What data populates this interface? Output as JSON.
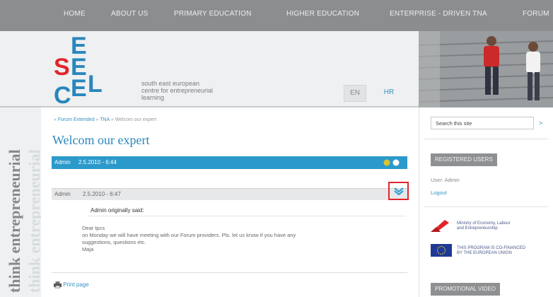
{
  "nav": {
    "items": [
      "HOME",
      "ABOUT US",
      "PRIMARY EDUCATION",
      "HIGHER EDUCATION",
      "ENTERPRISE - DRIVEN TNA",
      "FORUM"
    ]
  },
  "logo": {
    "letters": [
      "S",
      "E",
      "E",
      "C",
      "E",
      "L"
    ],
    "subtitle": [
      "south east european",
      "centre for entrepreneurial",
      "learning"
    ]
  },
  "languages": [
    "EN",
    "HR"
  ],
  "sidebar": {
    "tagline": "think entrepreneurial"
  },
  "breadcrumb": [
    "Forum Extended",
    "TNA",
    "Welcom our expert"
  ],
  "page": {
    "title": "Welcom our expert"
  },
  "posts": [
    {
      "author": "Admin",
      "date": "2.5.2010 - 6:44"
    },
    {
      "author": "Admin",
      "date": "2.5.2010 - 6:47"
    }
  ],
  "quote": {
    "title": "Admin originally said:"
  },
  "post_body": [
    "Dear tpcs",
    "on Monday we will have meeting with our Forum providers. Pls. let us know if you have any",
    "suggestions, questions etc.",
    "Maja"
  ],
  "print_label": "Print page",
  "search": {
    "placeholder": "Search this site",
    "go": ">"
  },
  "registered": {
    "heading": "REGISTERED USERS",
    "user": "User: Admin",
    "logout": "Logout"
  },
  "partners": [
    {
      "text": [
        "Ministry of Economy, Labour",
        "and Entrepreneurship"
      ]
    },
    {
      "text": [
        "THIS PROGRAM IS CO-FINANCED",
        "BY THE EUROPEAN UNION"
      ]
    }
  ],
  "promo": {
    "heading": "PROMOTIONAL VIDEO"
  },
  "colors": {
    "accent": "#2b9acb",
    "nav_bg": "#8b8d8e",
    "highlight": "#e2252a"
  }
}
